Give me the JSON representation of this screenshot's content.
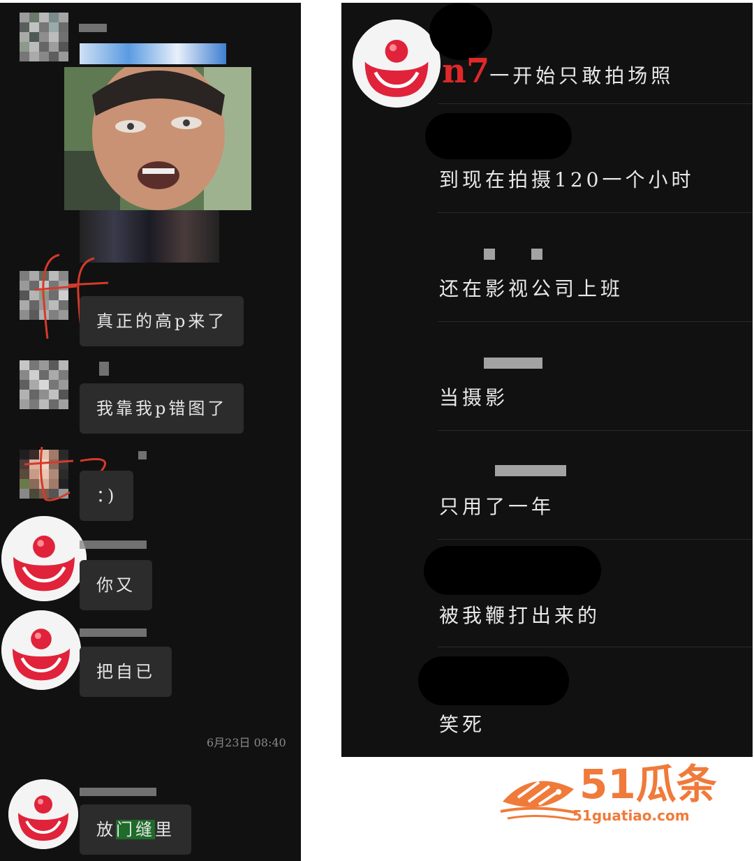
{
  "left_chat": {
    "messages": [
      {
        "text": "真正的高p来了"
      },
      {
        "text": "我靠我p错图了"
      },
      {
        "text": "：)"
      },
      {
        "text": "你又"
      },
      {
        "text": "把自已"
      },
      {
        "text_before": "放",
        "text_highlight": "门缝",
        "text_after": "里"
      }
    ],
    "timestamp": "6月23日 08:40",
    "annotations": [
      "ff",
      "tz"
    ]
  },
  "right_chat": {
    "title_prefix": "n7",
    "messages": [
      {
        "text": "一开始只敢拍场照"
      },
      {
        "text": "到现在拍摄120一个小时"
      },
      {
        "text": "还在影视公司上班"
      },
      {
        "text": "当摄影"
      },
      {
        "text": "只用了一年"
      },
      {
        "text": "被我鞭打出来的"
      },
      {
        "text": "笑死"
      }
    ]
  },
  "watermark": {
    "brand": "51瓜条",
    "url": "51guatiao.com",
    "color": "#f07a3a"
  }
}
